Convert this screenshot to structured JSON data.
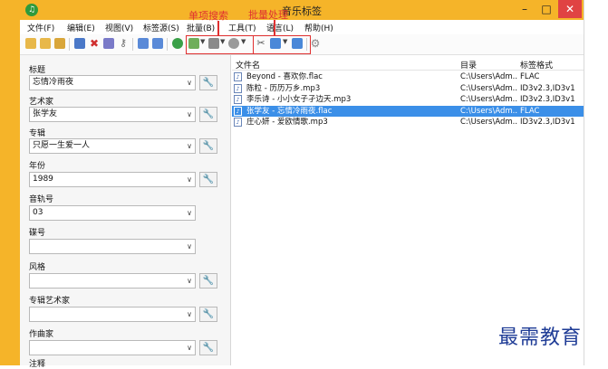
{
  "window": {
    "title": "音乐标签",
    "minimize_glyph": "–",
    "maximize_glyph": "□",
    "close_glyph": "✕"
  },
  "menu": [
    "文件(F)",
    "编辑(E)",
    "视图(V)",
    "标签源(S)",
    "批量(B)",
    "工具(T)",
    "语言(L)",
    "帮助(H)"
  ],
  "annotations": {
    "search_label": "单项搜索",
    "batch_label": "批量处理"
  },
  "fields": [
    {
      "label": "标题",
      "value": "忘情冷雨夜",
      "has_wrench": true
    },
    {
      "label": "艺术家",
      "value": "张学友",
      "has_wrench": true
    },
    {
      "label": "专辑",
      "value": "只愿一生爱一人",
      "has_wrench": true
    },
    {
      "label": "年份",
      "value": "1989",
      "has_wrench": true
    },
    {
      "label": "音轨号",
      "value": "03",
      "has_wrench": false
    },
    {
      "label": "碟号",
      "value": "",
      "has_wrench": false
    },
    {
      "label": "风格",
      "value": "",
      "has_wrench": true
    },
    {
      "label": "专辑艺术家",
      "value": "",
      "has_wrench": true
    },
    {
      "label": "作曲家",
      "value": "",
      "has_wrench": true
    },
    {
      "label": "注释",
      "value": "",
      "has_wrench": false
    }
  ],
  "table": {
    "headers": {
      "name": "文件名",
      "dir": "目录",
      "format": "标签格式"
    },
    "rows": [
      {
        "name": "Beyond - 喜欢你.flac",
        "dir": "C:\\Users\\Adm...",
        "format": "FLAC",
        "selected": false,
        "icon": "flac"
      },
      {
        "name": "陈粒 - 历历万乡.mp3",
        "dir": "C:\\Users\\Adm...",
        "format": "ID3v2.3,ID3v1",
        "selected": false,
        "icon": "mp3"
      },
      {
        "name": "李乐诗 - 小小女子孑边天.mp3",
        "dir": "C:\\Users\\Adm...",
        "format": "ID3v2.3,ID3v1",
        "selected": false,
        "icon": "mp3"
      },
      {
        "name": "张学友 - 忘情冷雨夜.flac",
        "dir": "C:\\Users\\Adm...",
        "format": "FLAC",
        "selected": true,
        "icon": "flac"
      },
      {
        "name": "庄心妍 - 爱欧情歌.mp3",
        "dir": "C:\\Users\\Adm...",
        "format": "ID3v2.3,ID3v1",
        "selected": false,
        "icon": "mp3"
      }
    ]
  },
  "watermark": "最需教育",
  "colors": {
    "accent": "#f5b429",
    "selection": "#3b8fe8",
    "annotation": "#e03030"
  }
}
